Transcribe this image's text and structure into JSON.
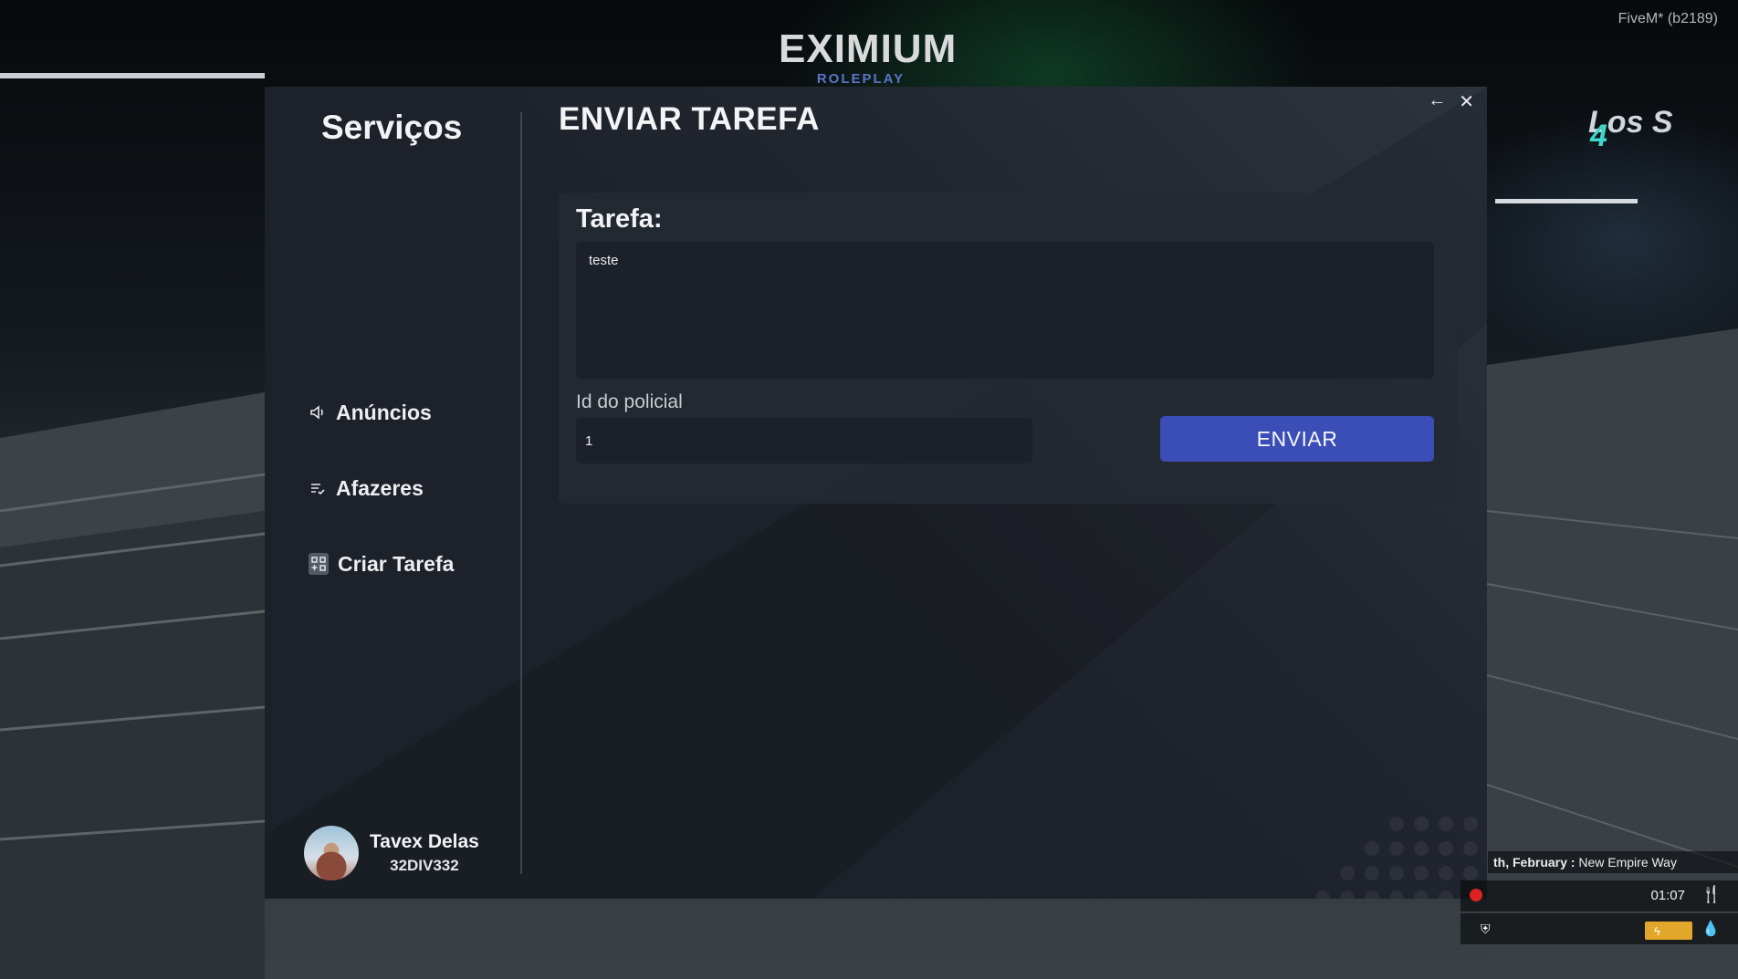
{
  "hud_top": {
    "client_label": "FiveM* (b2189)"
  },
  "logo": {
    "main": "EXIMIUM",
    "sub": "ROLEPLAY"
  },
  "sidebar": {
    "title": "Serviços",
    "items": [
      {
        "label": "Anúncios",
        "icon": "speaker-icon"
      },
      {
        "label": "Afazeres",
        "icon": "checklist-icon"
      },
      {
        "label": "Criar Tarefa",
        "icon": "grid-add-icon",
        "active": true
      }
    ],
    "user": {
      "name": "Tavex Delas",
      "id": "32DIV332"
    }
  },
  "main": {
    "title": "ENVIAR TAREFA",
    "task_label": "Tarefa:",
    "task_value": "teste",
    "officer_id_label": "Id do policial",
    "officer_id_value": "1",
    "send_button": "ENVIAR"
  },
  "window": {
    "back_icon": "←",
    "close_icon": "✕"
  },
  "hud": {
    "date": "th, February",
    "separator": ":",
    "location": "New Empire Way",
    "time": "01:07"
  },
  "colors": {
    "panel_bg": "#1d2129",
    "accent_button": "#3b4db6",
    "logo_sub": "#5b74c9",
    "energy": "#e2a62b"
  }
}
